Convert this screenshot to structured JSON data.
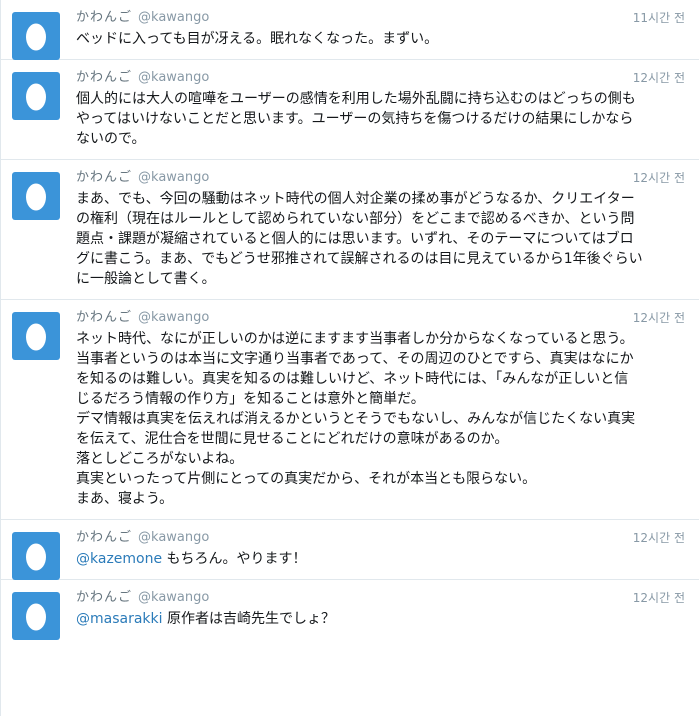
{
  "colors": {
    "avatar_bg": "#3b94d9",
    "egg": "#ffffff",
    "link": "#2b7bb9",
    "meta": "#8899a6",
    "divider": "#e1e8ed"
  },
  "icons": {
    "avatar": "egg-icon"
  },
  "tweets": [
    {
      "fullname": "かわんご",
      "screenname": "@kawango",
      "time": "11시간 전",
      "mention": "",
      "lines": [
        "ベッドに入っても目が冴える。眠れなくなった。まずい。"
      ]
    },
    {
      "fullname": "かわんご",
      "screenname": "@kawango",
      "time": "12시간 전",
      "mention": "",
      "lines": [
        "個人的には大人の喧嘩をユーザーの感情を利用した場外乱闘に持ち込むのはどっちの側も",
        "やってはいけないことだと思います。ユーザーの気持ちを傷つけるだけの結果にしかなら",
        "ないので。"
      ]
    },
    {
      "fullname": "かわんご",
      "screenname": "@kawango",
      "time": "12시간 전",
      "mention": "",
      "lines": [
        "まあ、でも、今回の騒動はネット時代の個人対企業の揉め事がどうなるか、クリエイター",
        "の権利（現在はルールとして認められていない部分）をどこまで認めるべきか、という問",
        "題点・課題が凝縮されていると個人的には思います。いずれ、そのテーマについてはブロ",
        "グに書こう。まあ、でもどうせ邪推されて誤解されるのは目に見えているから1年後ぐらい",
        "に一般論として書く。"
      ]
    },
    {
      "fullname": "かわんご",
      "screenname": "@kawango",
      "time": "12시간 전",
      "mention": "",
      "lines": [
        "ネット時代、なにが正しいのかは逆にますます当事者しか分からなくなっていると思う。",
        "当事者というのは本当に文字通り当事者であって、その周辺のひとですら、真実はなにか",
        "を知るのは難しい。真実を知るのは難しいけど、ネット時代には、「みんなが正しいと信",
        "じるだろう情報の作り方」を知ることは意外と簡単だ。",
        "デマ情報は真実を伝えれば消えるかというとそうでもないし、みんなが信じたくない真実",
        "を伝えて、泥仕合を世間に見せることにどれだけの意味があるのか。",
        "落としどころがないよね。",
        "真実といったって片側にとっての真実だから、それが本当とも限らない。",
        "まあ、寝よう。"
      ]
    },
    {
      "fullname": "かわんご",
      "screenname": "@kawango",
      "time": "12시간 전",
      "mention": "@kazemone",
      "lines": [
        " もちろん。やります！"
      ]
    },
    {
      "fullname": "かわんご",
      "screenname": "@kawango",
      "time": "12시간 전",
      "mention": "@masarakki",
      "lines": [
        " 原作者は吉崎先生でしょ？"
      ]
    }
  ]
}
